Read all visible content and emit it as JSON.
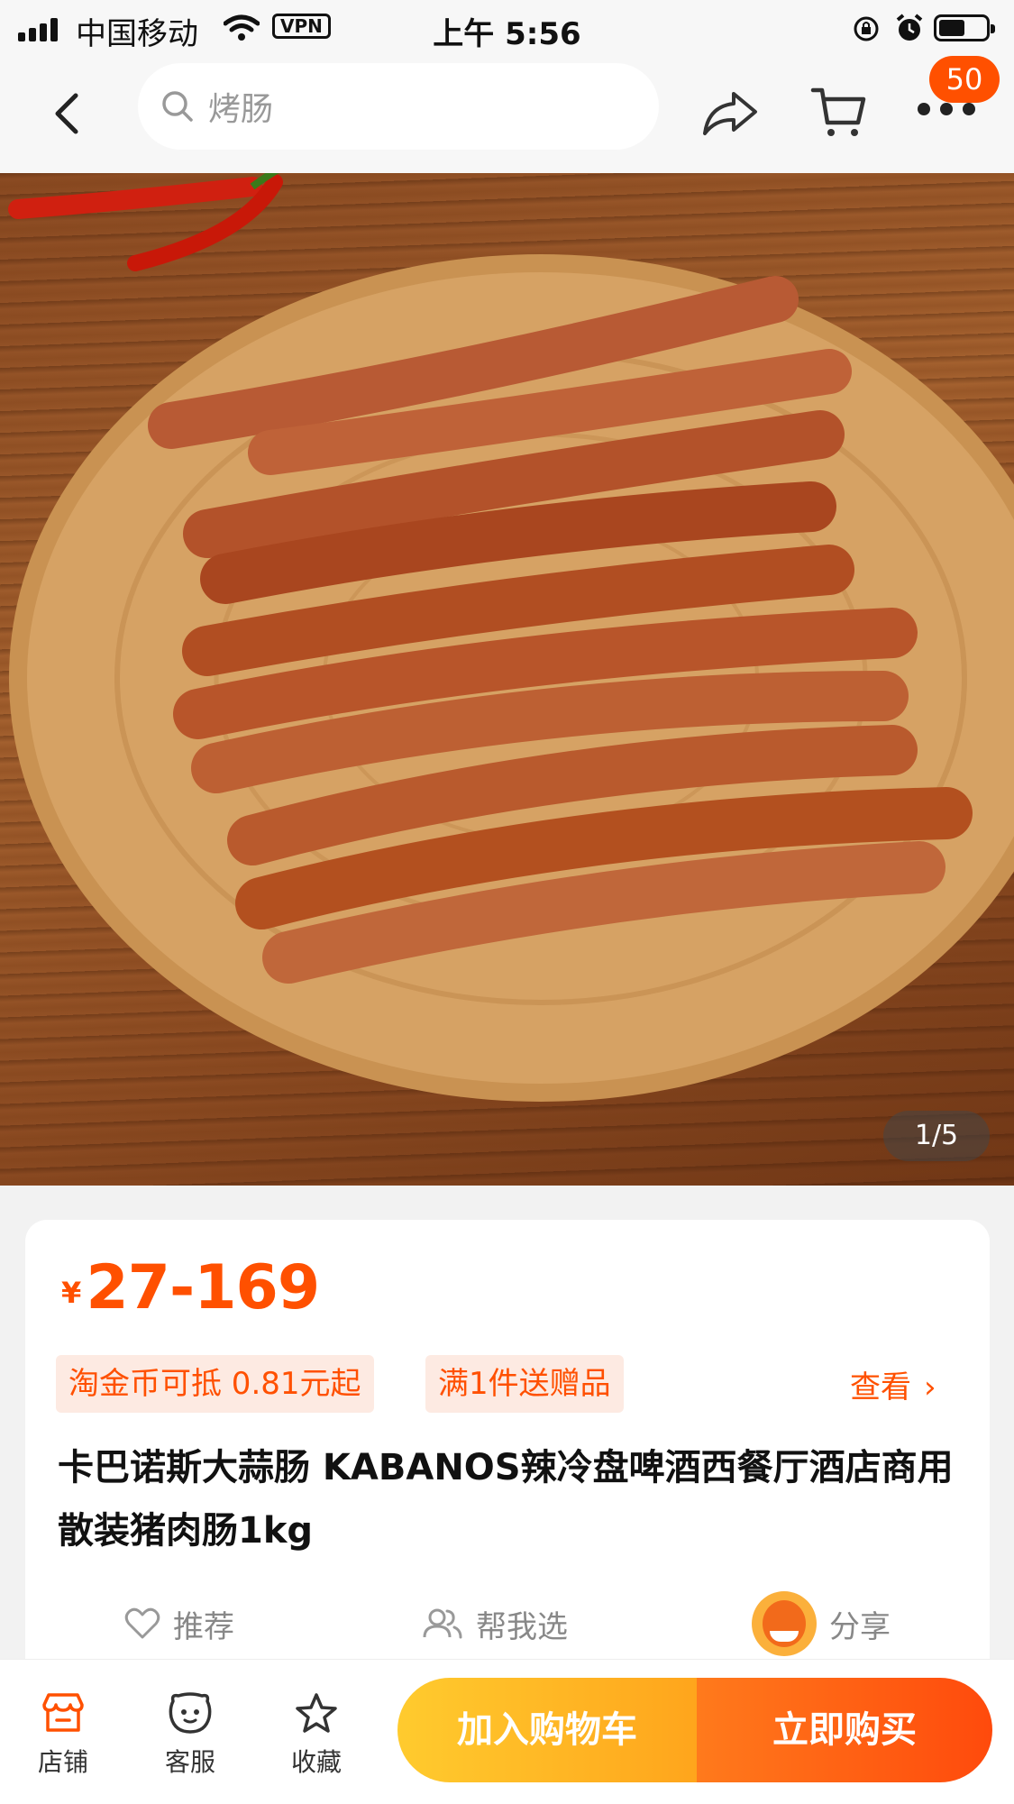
{
  "status_bar": {
    "carrier": "中国移动",
    "vpn": "VPN",
    "time": "上午 5:56"
  },
  "nav": {
    "search_text": "烤肠",
    "cart_badge": "50"
  },
  "gallery": {
    "counter": "1/5"
  },
  "product": {
    "currency": "¥",
    "price": "27-169",
    "tags": [
      "淘金币可抵 0.81元起",
      "满1件送赠品"
    ],
    "view_label": "查看",
    "title": "卡巴诺斯大蒜肠 KABANOS辣冷盘啤酒西餐厅酒店商用散装猪肉肠1kg",
    "actions": {
      "recommend": "推荐",
      "help_choose": "帮我选",
      "share": "分享"
    }
  },
  "bottom_bar": {
    "shop": "店铺",
    "service": "客服",
    "favorite": "收藏",
    "add_to_cart": "加入购物车",
    "buy_now": "立即购买"
  },
  "colors": {
    "accent": "#ff5000",
    "cart_button": "#ffb21f",
    "buy_button": "#ff5a10"
  }
}
